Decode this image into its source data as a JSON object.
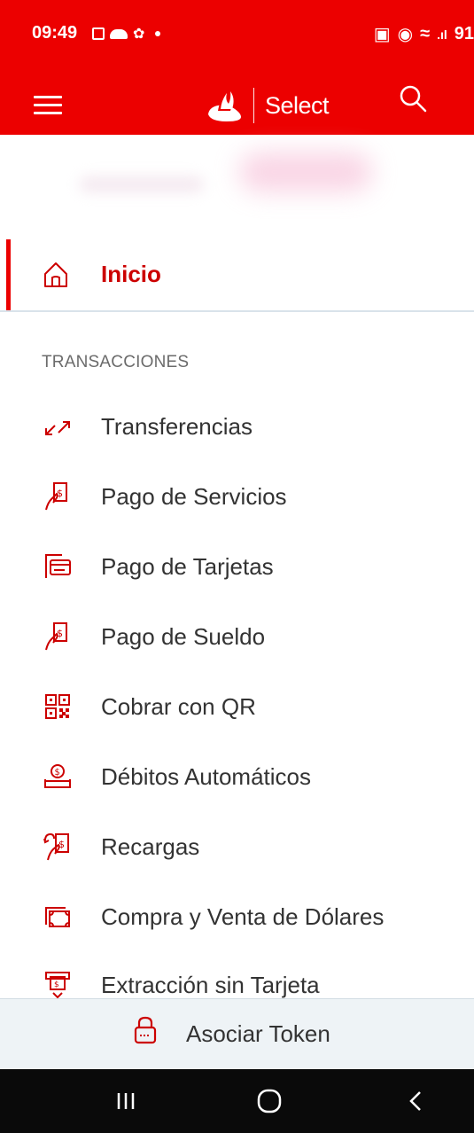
{
  "status_bar": {
    "time": "09:49",
    "battery": "91"
  },
  "header": {
    "brand_name": "Select"
  },
  "menu": {
    "inicio_label": "Inicio",
    "section_title": "TRANSACCIONES",
    "items": [
      {
        "label": "Transferencias",
        "icon": "transfer-arrows-icon"
      },
      {
        "label": "Pago de Servicios",
        "icon": "hand-receipt-icon"
      },
      {
        "label": "Pago de Tarjetas",
        "icon": "card-payment-icon"
      },
      {
        "label": "Pago de Sueldo",
        "icon": "hand-receipt-icon"
      },
      {
        "label": "Cobrar con QR",
        "icon": "qr-code-icon"
      },
      {
        "label": "Débitos Automáticos",
        "icon": "coin-tray-icon"
      },
      {
        "label": "Recargas",
        "icon": "recharge-icon"
      },
      {
        "label": "Compra y Venta de Dólares",
        "icon": "currency-exchange-icon"
      },
      {
        "label": "Extracción sin Tarjeta",
        "icon": "atm-withdraw-icon"
      }
    ]
  },
  "token": {
    "label": "Asociar Token"
  },
  "colors": {
    "brand_red": "#ec0000",
    "icon_red": "#cc0000",
    "text": "#333333"
  }
}
